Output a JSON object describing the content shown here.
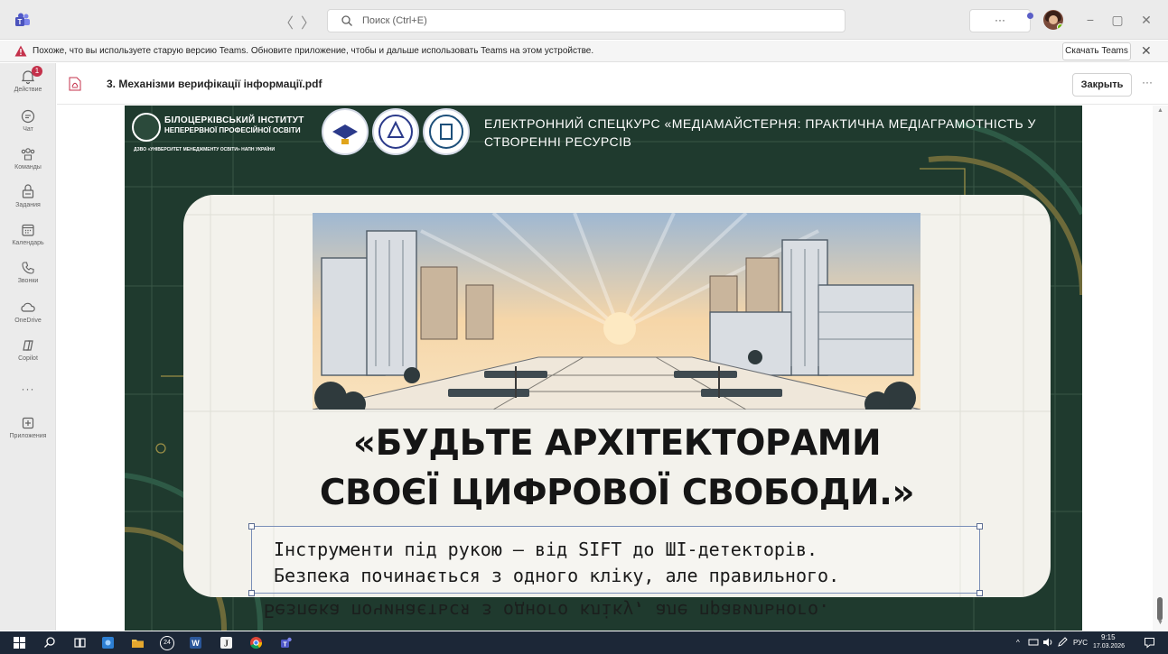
{
  "titlebar": {
    "search_placeholder": "Поиск (Ctrl+E)",
    "more_label": "···",
    "back_glyph": "〈",
    "forward_glyph": "〉",
    "minimize_glyph": "−",
    "restore_glyph": "▢",
    "close_glyph": "✕"
  },
  "warning": {
    "text": "Похоже, что вы используете старую версию Teams. Обновите приложение, чтобы и дальше использовать Teams на этом устройстве.",
    "download_label": "Скачать Teams",
    "close_glyph": "✕"
  },
  "rail": {
    "items": [
      {
        "label": "Действие",
        "icon": "bell-icon",
        "badge": "1"
      },
      {
        "label": "Чат",
        "icon": "chat-icon"
      },
      {
        "label": "Команды",
        "icon": "teams-icon"
      },
      {
        "label": "Задания",
        "icon": "assignments-icon"
      },
      {
        "label": "Календарь",
        "icon": "calendar-icon"
      },
      {
        "label": "Звонки",
        "icon": "phone-icon"
      },
      {
        "label": "OneDrive",
        "icon": "onedrive-icon"
      },
      {
        "label": "Copilot",
        "icon": "copilot-icon"
      },
      {
        "label": "···",
        "icon": "more-icon"
      },
      {
        "label": "Приложения",
        "icon": "apps-icon"
      }
    ]
  },
  "file": {
    "title": "3. Механізми верифікації інформації.pdf",
    "close_label": "Закрыть",
    "more_label": "···"
  },
  "slide": {
    "institute_line1": "БІЛОЦЕРКІВСЬКИЙ ІНСТИТУТ",
    "institute_line2": "НЕПЕРЕРВНОЇ ПРОФЕСІЙНОЇ ОСВІТИ",
    "institute_line3": "ДЗВО «УНІВЕРСИТЕТ МЕНЕДЖМЕНТУ ОСВІТИ» НАПН УКРАЇНИ",
    "course_title": "ЕЛЕКТРОННИЙ СПЕЦКУРС «МЕДІАМАЙСТЕРНЯ: ПРАКТИЧНА МЕДІАГРАМОТНІСТЬ У СТВОРЕННІ РЕСУРСІВ",
    "quote_line1": "«БУДЬТЕ АРХІТЕКТОРАМИ",
    "quote_line2": "СВОЄЇ ЦИФРОВОЇ СВОБОДИ.»",
    "sub_line1": "Інструменти під рукою – від SIFT до ШІ-детекторів.",
    "sub_line2": "Безпека починається з одного кліку, але правильного.",
    "accent_color": "#1f3a2e"
  },
  "taskbar": {
    "tray_lang": "РУС",
    "tray_time": "9:15",
    "tray_date": "17.03.2026",
    "notification_count": "24"
  }
}
